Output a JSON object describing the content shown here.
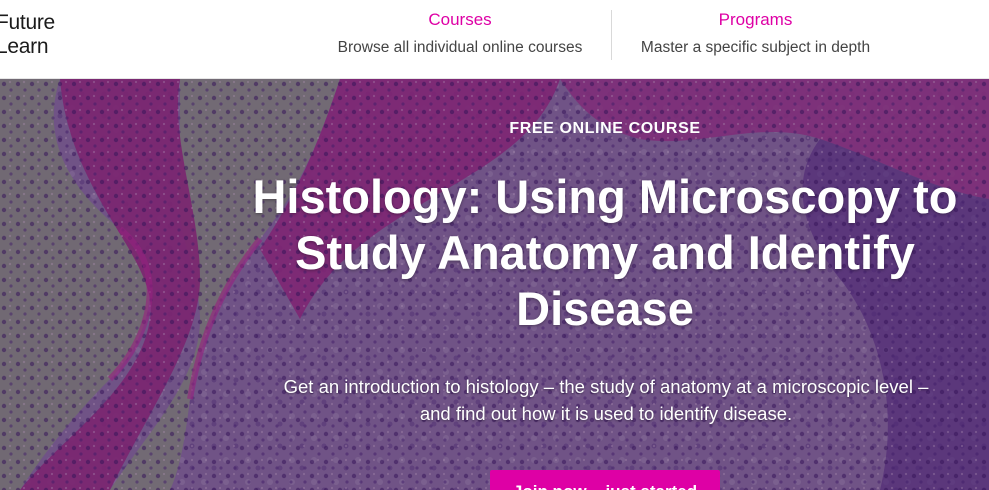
{
  "header": {
    "logo": {
      "line1": "Future",
      "line2": "Learn"
    },
    "nav": [
      {
        "title": "Courses",
        "subtitle": "Browse all individual online courses"
      },
      {
        "title": "Programs",
        "subtitle": "Master a specific subject in depth"
      }
    ]
  },
  "hero": {
    "eyebrow": "FREE ONLINE COURSE",
    "title": "Histology: Using Microscopy to Study Anatomy and Identify Disease",
    "description": "Get an introduction to histology – the study of anatomy at a microscopic level – and find out how it is used to identify disease.",
    "cta_label": "Join now – just started"
  },
  "colors": {
    "accent": "#de00a5",
    "header_bg": "#ffffff",
    "hero_tint": "#7f4a86"
  }
}
